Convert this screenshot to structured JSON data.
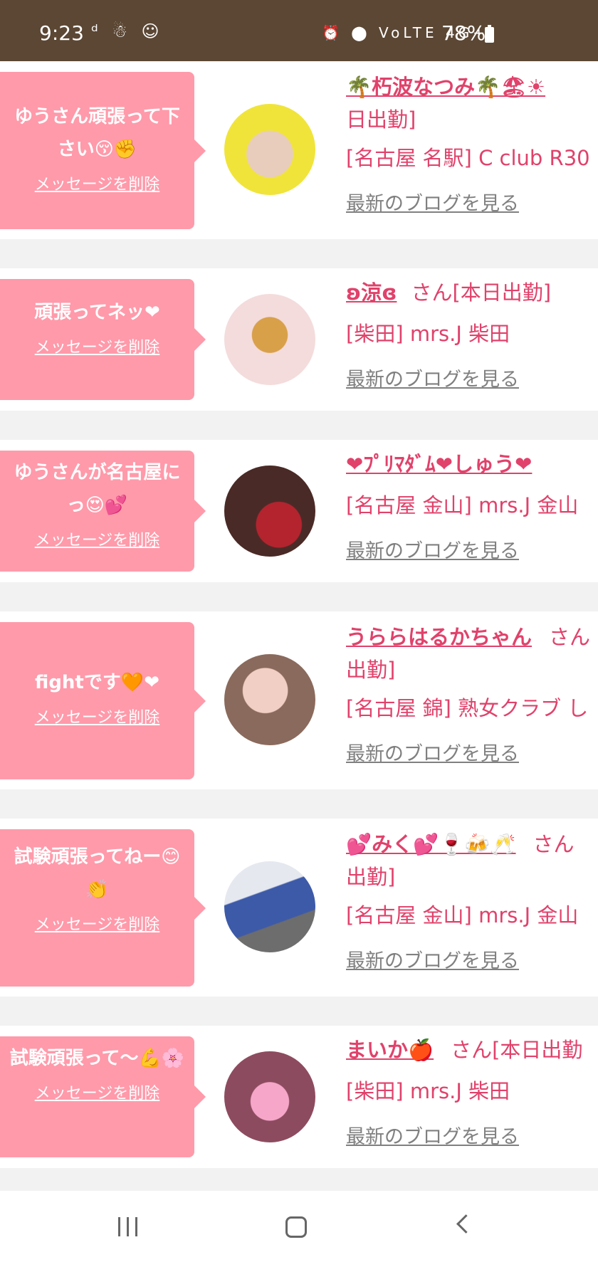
{
  "status_bar": {
    "time": "9:23",
    "left_icons": "ᵈ ☃ ☺",
    "right_icons": "⏰ ⬤ VoLTE 4G+",
    "signal": "▂▄▆",
    "battery": "78%"
  },
  "messages": [
    {
      "message": "ゆうさん頑張って下さい😚✊",
      "delete_label": "メッセージを削除",
      "name": "🌴朽波なつみ🌴🏖☀",
      "suffix": "",
      "line2": "日出勤]",
      "shop": "[名古屋 名駅] C club R30",
      "blog": "最新のブログを見る"
    },
    {
      "message": "頑張ってネッ❤",
      "delete_label": "メッセージを削除",
      "name": "ʚ涼ɞ",
      "suffix": "さん[本日出勤]",
      "line2": "",
      "shop": "[柴田] mrs.J 柴田",
      "blog": "最新のブログを見る"
    },
    {
      "message": "ゆうさんが名古屋にっ😍💕",
      "delete_label": "メッセージを削除",
      "name": "❤ﾌﾟﾘﾏﾀﾞﾑ❤しゅう❤",
      "suffix": "",
      "line2": "",
      "shop": "[名古屋 金山] mrs.J 金山",
      "blog": "最新のブログを見る"
    },
    {
      "message": "fightです🧡❤",
      "delete_label": "メッセージを削除",
      "name": "うららはるかちゃん",
      "suffix": "さん",
      "line2": "出勤]",
      "shop": "[名古屋 錦] 熟女クラブ し",
      "blog": "最新のブログを見る"
    },
    {
      "message": "試験頑張ってねー😊👏",
      "delete_label": "メッセージを削除",
      "name": "💕みく💕🍷🍻🥂",
      "suffix": "さん",
      "line2": "出勤]",
      "shop": "[名古屋 金山] mrs.J 金山",
      "blog": "最新のブログを見る"
    },
    {
      "message": "試験頑張って〜💪🌸",
      "delete_label": "メッセージを削除",
      "name": "まいか🍎",
      "suffix": "さん[本日出勤",
      "line2": "",
      "shop": "[柴田] mrs.J 柴田",
      "blog": "最新のブログを見る"
    }
  ],
  "nav": {
    "recent_icon": "recent-apps-icon",
    "home_icon": "home-icon",
    "back_icon": "back-icon"
  },
  "colors": {
    "status_bar": "#5c4734",
    "bubble": "#ff9aaa",
    "accent_text": "#e0426b",
    "link_gray": "#808080"
  }
}
